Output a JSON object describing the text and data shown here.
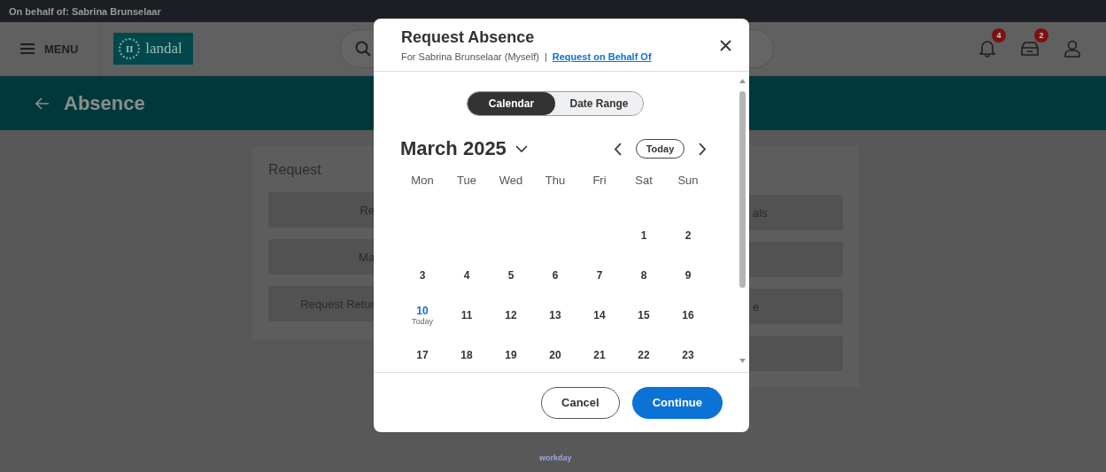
{
  "top_bar": {
    "text": "On behalf of: Sabrina Brunselaar"
  },
  "header": {
    "menu_label": "MENU",
    "logo": {
      "mark": "II",
      "text": "landal"
    },
    "notifications_badge": "4",
    "inbox_badge": "2"
  },
  "page_title": "Absence",
  "cards": [
    {
      "title": "Request",
      "buttons": [
        "Re",
        "Ma",
        "Request Retur"
      ]
    },
    {
      "buttons": [
        {
          "kind": "task",
          "label": "als"
        },
        {
          "kind": "covered"
        },
        {
          "kind": "task",
          "label": "e"
        },
        {
          "kind": "covered"
        }
      ]
    }
  ],
  "footer_logo": "workday",
  "dialog": {
    "title": "Request Absence",
    "subtitle": "For Sabrina Brunselaar (Myself)",
    "separator": "|",
    "link": "Request on Behalf Of",
    "view_toggle": [
      {
        "label": "Calendar",
        "selected": true
      },
      {
        "label": "Date Range",
        "selected": false
      }
    ],
    "month": "March 2025",
    "today_button": "Today",
    "weekdays": [
      "Mon",
      "Tue",
      "Wed",
      "Thu",
      "Fri",
      "Sat",
      "Sun"
    ],
    "weeks": [
      [
        {
          "kind": "empty"
        },
        {
          "kind": "empty"
        },
        {
          "kind": "empty"
        },
        {
          "kind": "empty"
        },
        {
          "kind": "empty"
        },
        {
          "kind": "day",
          "date": "1"
        },
        {
          "kind": "day",
          "date": "2"
        }
      ],
      [
        {
          "kind": "day",
          "date": "3"
        },
        {
          "kind": "day",
          "date": "4"
        },
        {
          "kind": "day",
          "date": "5"
        },
        {
          "kind": "day",
          "date": "6"
        },
        {
          "kind": "day",
          "date": "7"
        },
        {
          "kind": "day",
          "date": "8"
        },
        {
          "kind": "day",
          "date": "9"
        }
      ],
      [
        {
          "kind": "day",
          "date": "10",
          "today": true,
          "note": "Today"
        },
        {
          "kind": "day",
          "date": "11"
        },
        {
          "kind": "day",
          "date": "12"
        },
        {
          "kind": "day",
          "date": "13"
        },
        {
          "kind": "day",
          "date": "14"
        },
        {
          "kind": "day",
          "date": "15"
        },
        {
          "kind": "day",
          "date": "16"
        }
      ],
      [
        {
          "kind": "day",
          "date": "17"
        },
        {
          "kind": "day",
          "date": "18"
        },
        {
          "kind": "day",
          "date": "19"
        },
        {
          "kind": "day",
          "date": "20"
        },
        {
          "kind": "day",
          "date": "21"
        },
        {
          "kind": "day",
          "date": "22"
        },
        {
          "kind": "day",
          "date": "23"
        }
      ]
    ],
    "buttons": [
      {
        "label": "Cancel",
        "kind": "secondary"
      },
      {
        "label": "Continue",
        "kind": "primary"
      }
    ]
  }
}
